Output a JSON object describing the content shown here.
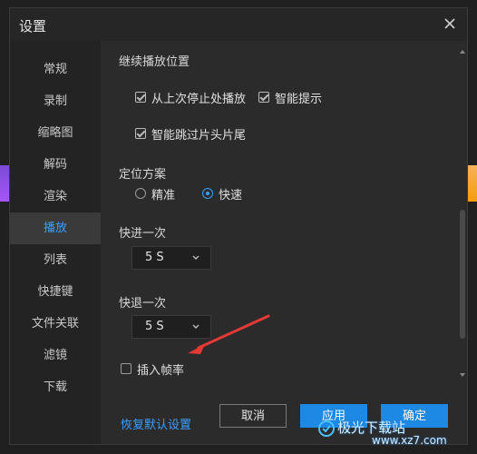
{
  "window": {
    "title": "设置"
  },
  "sidebar": {
    "items": [
      {
        "label": "常规"
      },
      {
        "label": "录制"
      },
      {
        "label": "缩略图"
      },
      {
        "label": "解码"
      },
      {
        "label": "渲染"
      },
      {
        "label": "播放",
        "active": true
      },
      {
        "label": "列表"
      },
      {
        "label": "快捷键"
      },
      {
        "label": "文件关联"
      },
      {
        "label": "滤镜"
      },
      {
        "label": "下载"
      }
    ]
  },
  "content": {
    "resume": {
      "title": "继续播放位置",
      "options": {
        "resume_from_last_stop": {
          "label": "从上次停止处播放",
          "checked": true
        },
        "smart_tip": {
          "label": "智能提示",
          "checked": true
        },
        "skip_intro_outro": {
          "label": "智能跳过片头片尾",
          "checked": true
        }
      }
    },
    "seek": {
      "title": "定位方案",
      "options": {
        "accurate": {
          "label": "精准",
          "selected": false
        },
        "fast": {
          "label": "快速",
          "selected": true
        }
      }
    },
    "fast_forward": {
      "title": "快进一次",
      "value": "5 S"
    },
    "rewind": {
      "title": "快退一次",
      "value": "5 S"
    },
    "insert_frame_rate": {
      "label": "插入帧率",
      "checked": false
    }
  },
  "footer": {
    "restore_link": "恢复默认设置",
    "cancel": "取消",
    "apply": "应用",
    "ok": "确定"
  },
  "watermark": {
    "text": "极光下载站",
    "url": "www.xz7.com"
  },
  "colors": {
    "accent": "#3aa0ff",
    "button_primary": "#1e88e5",
    "annotation_arrow": "#e53935"
  }
}
